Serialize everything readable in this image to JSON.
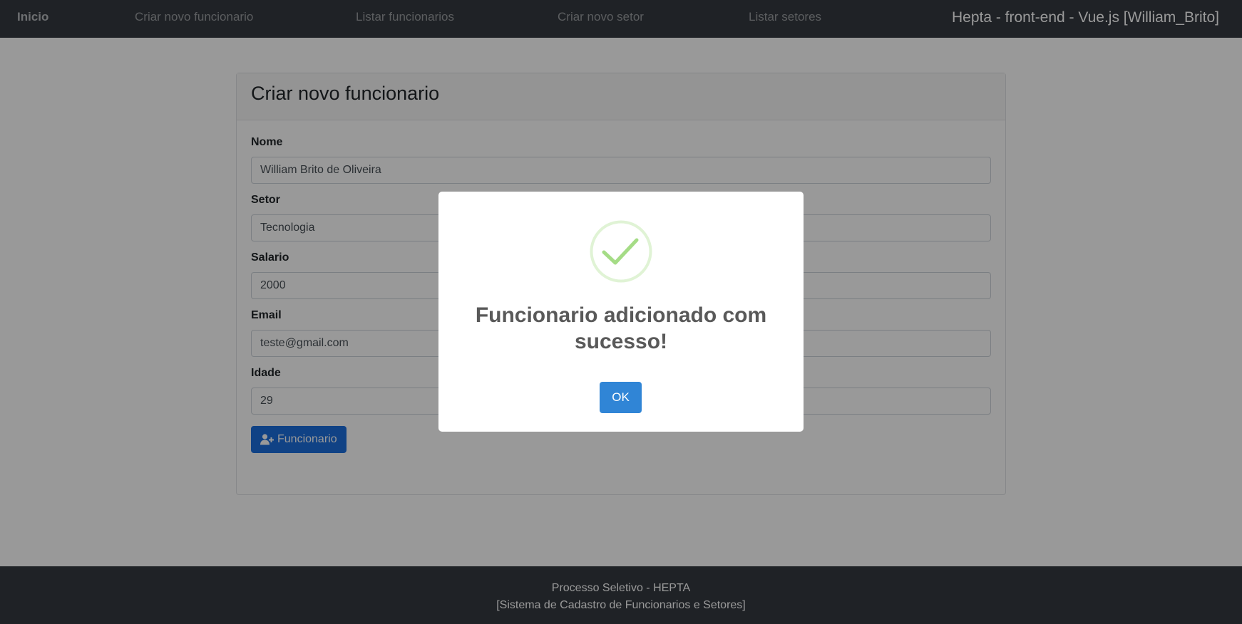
{
  "navbar": {
    "home": "Inicio",
    "items": [
      {
        "label": "Criar novo funcionario"
      },
      {
        "label": "Listar funcionarios"
      },
      {
        "label": "Criar novo setor"
      },
      {
        "label": "Listar setores"
      }
    ],
    "brand": "Hepta - front-end - Vue.js [William_Brito]"
  },
  "form": {
    "title": "Criar novo funcionario",
    "fields": [
      {
        "label": "Nome",
        "value": "William Brito de Oliveira"
      },
      {
        "label": "Setor",
        "value": "Tecnologia"
      },
      {
        "label": "Salario",
        "value": "2000"
      },
      {
        "label": "Email",
        "value": "teste@gmail.com"
      },
      {
        "label": "Idade",
        "value": "29"
      }
    ],
    "submit_label": "Funcionario",
    "submit_icon": "user-plus-icon"
  },
  "footer": {
    "line1": "Processo Seletivo - HEPTA",
    "line2": "[Sistema de Cadastro de Funcionarios e Setores]"
  },
  "modal": {
    "icon": "success-check-icon",
    "title": "Funcionario adicionado com sucesso!",
    "ok_label": "OK"
  },
  "colors": {
    "navbar": "#343a40",
    "primary_button": "#1b6ede",
    "modal_ok": "#3085d6",
    "success": "#a5dc86"
  }
}
